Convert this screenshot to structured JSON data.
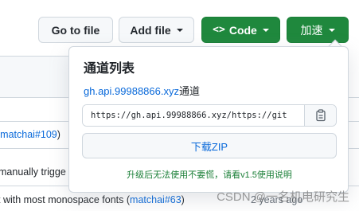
{
  "toolbar": {
    "go_to_file": "Go to file",
    "add_file": "Add file",
    "code": "Code",
    "accelerate": "加速"
  },
  "background_rows": [
    {
      "prefix": "(",
      "link": "matchai#109",
      "suffix": ")"
    },
    {
      "text": "manually trigge"
    },
    {
      "prefix": "t with most monospace fonts (",
      "link": "matchai#63",
      "suffix": ")",
      "time": "2 years ago"
    }
  ],
  "popover": {
    "title": "通道列表",
    "mirror_host": "gh.api.99988866.xyz",
    "mirror_suffix": "通道",
    "url_value": "https://gh.api.99988866.xyz/https://git",
    "download_label": "下载ZIP",
    "notice": "升级后无法使用不要慌，请看v1.5使用说明"
  },
  "watermark": "CSDN @一名机电研究生",
  "icons": [
    "caret-down-icon",
    "code-brackets-icon",
    "copy-clipboard-icon"
  ],
  "colors": {
    "primary_green": "#1f883d",
    "link_blue": "#0969da",
    "notice_green": "#1a7f37",
    "border": "#d0d7de"
  }
}
